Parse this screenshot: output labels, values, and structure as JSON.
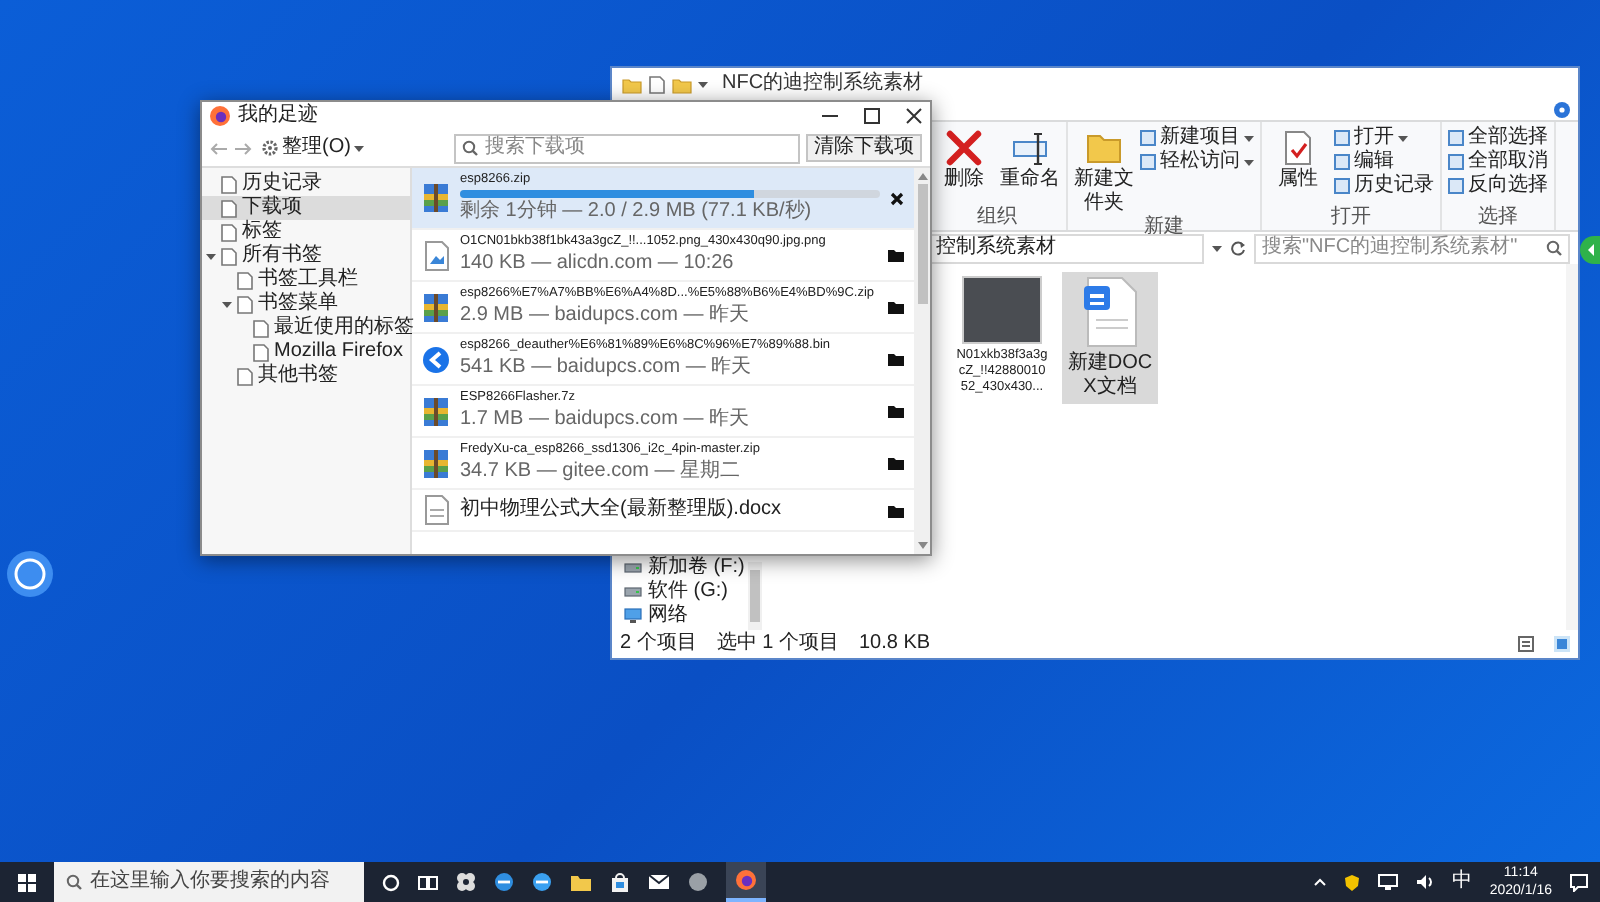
{
  "library_window": {
    "title": "我的足迹",
    "toolbar": {
      "organize_button": "整理(O)",
      "search": {
        "placeholder": "搜索下载项"
      },
      "clear_button": "清除下载项"
    },
    "sidebar": {
      "items": [
        {
          "label": "历史记录",
          "selected": false
        },
        {
          "label": "下载项",
          "selected": true
        },
        {
          "label": "标签",
          "selected": false
        },
        {
          "label": "所有书签",
          "selected": false,
          "expanded": true,
          "children": [
            {
              "label": "书签工具栏",
              "selected": false
            },
            {
              "label": "书签菜单",
              "selected": false,
              "expanded": true,
              "children": [
                {
                  "label": "最近使用的标签",
                  "selected": false
                },
                {
                  "label": "Mozilla Firefox",
                  "selected": false
                }
              ]
            },
            {
              "label": "其他书签",
              "selected": false
            }
          ]
        }
      ]
    },
    "downloads": [
      {
        "name": "esp8266.zip",
        "meta": "剩余 1分钟 — 2.0 / 2.9 MB (77.1 KB/秒)",
        "downloading": true,
        "level": 0.7,
        "kind": "archive",
        "selected": true
      },
      {
        "name": "O1CN01bkb38f1bk43a3gcZ_!!...1052.png_430x430q90.jpg.png",
        "meta": "140 KB — alicdn.com — 10:26",
        "downloading": false,
        "kind": "image",
        "selected": false
      },
      {
        "name": "esp8266%E7%A7%BB%E6%A4%8D...%E5%88%B6%E4%BD%9C.zip",
        "meta": "2.9 MB — baidupcs.com — 昨天",
        "downloading": false,
        "kind": "archive",
        "selected": false
      },
      {
        "name": "esp8266_deauther%E6%81%89%E6%8C%96%E7%89%88.bin",
        "meta": "541 KB — baidupcs.com — 昨天",
        "downloading": false,
        "kind": "app",
        "selected": false
      },
      {
        "name": "ESP8266Flasher.7z",
        "meta": "1.7 MB — baidupcs.com — 昨天",
        "downloading": false,
        "kind": "archive",
        "selected": false
      },
      {
        "name": "FredyXu-ca_esp8266_ssd1306_i2c_4pin-master.zip",
        "meta": "34.7 KB — gitee.com — 星期二",
        "downloading": false,
        "kind": "archive",
        "selected": false
      },
      {
        "name": "初中物理公式大全(最新整理版).docx",
        "downloading": false,
        "kind": "document",
        "selected": false
      }
    ]
  },
  "explorer_window": {
    "title": "NFC的迪控制系统素材",
    "ribbon": {
      "groups": [
        {
          "label": "组织",
          "items": [
            {
              "label": "删除",
              "kind": "large",
              "dropdown": false
            },
            {
              "label": "重命名",
              "kind": "large",
              "dropdown": false
            }
          ]
        },
        {
          "label": "新建",
          "items": [
            {
              "label": "新建文件夹",
              "kind": "large",
              "dropdown": false
            },
            {
              "label": "新建项目",
              "kind": "small",
              "dropdown": true
            },
            {
              "label": "轻松访问",
              "kind": "small",
              "dropdown": true
            }
          ]
        },
        {
          "label": "打开",
          "items": [
            {
              "label": "属性",
              "kind": "large",
              "dropdown": false
            },
            {
              "label": "打开",
              "kind": "small",
              "dropdown": true
            },
            {
              "label": "编辑",
              "kind": "small",
              "dropdown": false
            },
            {
              "label": "历史记录",
              "kind": "small",
              "dropdown": false
            }
          ]
        },
        {
          "label": "选择",
          "items": [
            {
              "label": "全部选择",
              "kind": "small",
              "dropdown": false
            },
            {
              "label": "全部取消",
              "kind": "small",
              "dropdown": false
            },
            {
              "label": "反向选择",
              "kind": "small",
              "dropdown": false
            }
          ]
        }
      ]
    },
    "address": "控制系统素材",
    "search": {
      "placeholder": "搜索\"NFC的迪控制系统素材\""
    },
    "nav_items": [
      {
        "label": "新加卷 (F:)",
        "kind": "drive"
      },
      {
        "label": "软件 (G:)",
        "kind": "drive"
      },
      {
        "label": "网络",
        "kind": "network"
      }
    ],
    "files": [
      {
        "name": "N01xkb38f3a3gcZ_!!4288001052_430x430...",
        "kind": "photo",
        "selected": false
      },
      {
        "name": "新建DOCX文档",
        "kind": "document",
        "selected": true
      }
    ],
    "status_bar": {
      "item_count": "2 个项目",
      "selection": "选中 1 个项目",
      "selection_size": "10.8 KB"
    }
  },
  "taskbar": {
    "search": {
      "placeholder": "在这里输入你要搜索的内容"
    },
    "input_method": "中",
    "time": "11:14",
    "date": "2020/1/16"
  }
}
